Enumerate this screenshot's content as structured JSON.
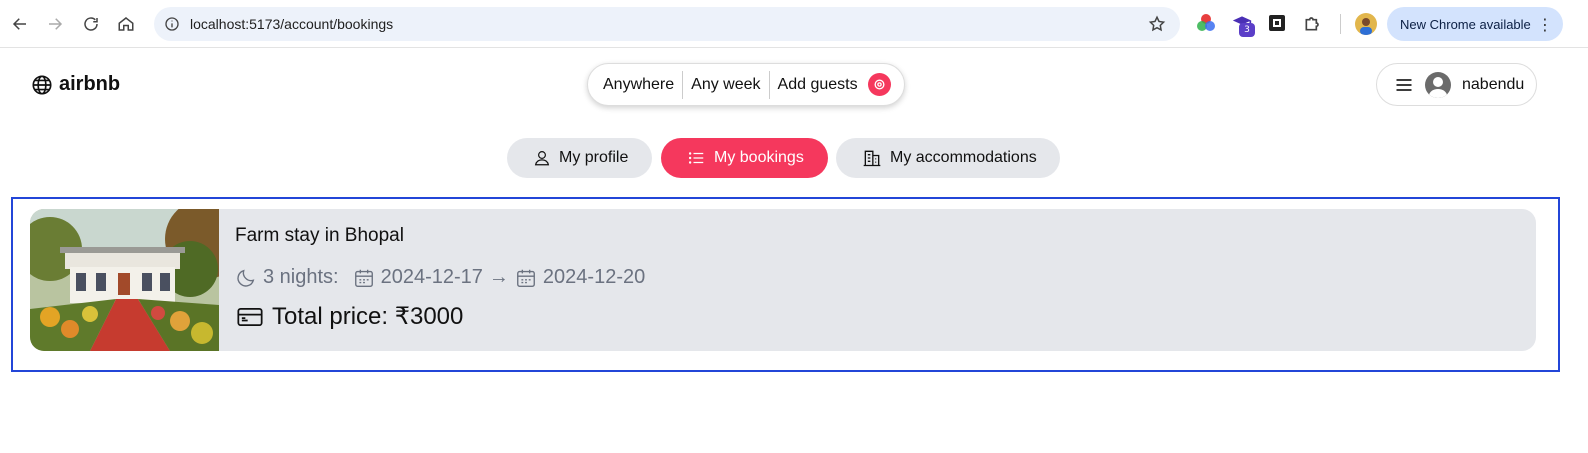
{
  "browser": {
    "url": "localhost:5173/account/bookings",
    "extension_badge": "3",
    "update_label": "New Chrome available"
  },
  "header": {
    "logo_text": "airbnb",
    "search": {
      "where": "Anywhere",
      "when": "Any week",
      "who": "Add guests"
    },
    "user_name": "nabendu"
  },
  "tabs": [
    {
      "label": "My profile",
      "icon": "user-icon",
      "active": false
    },
    {
      "label": "My bookings",
      "icon": "list-icon",
      "active": true
    },
    {
      "label": "My accommodations",
      "icon": "building-icon",
      "active": false
    }
  ],
  "booking": {
    "title": "Farm stay in Bhopal",
    "nights": "3 nights:",
    "check_in": "2024-12-17",
    "arrow": "→",
    "check_out": "2024-12-20",
    "price": "Total price: ₹3000"
  },
  "colors": {
    "accent": "#f5385d",
    "tab_bg": "#e5e7eb",
    "selection_outline": "#2346d8"
  }
}
